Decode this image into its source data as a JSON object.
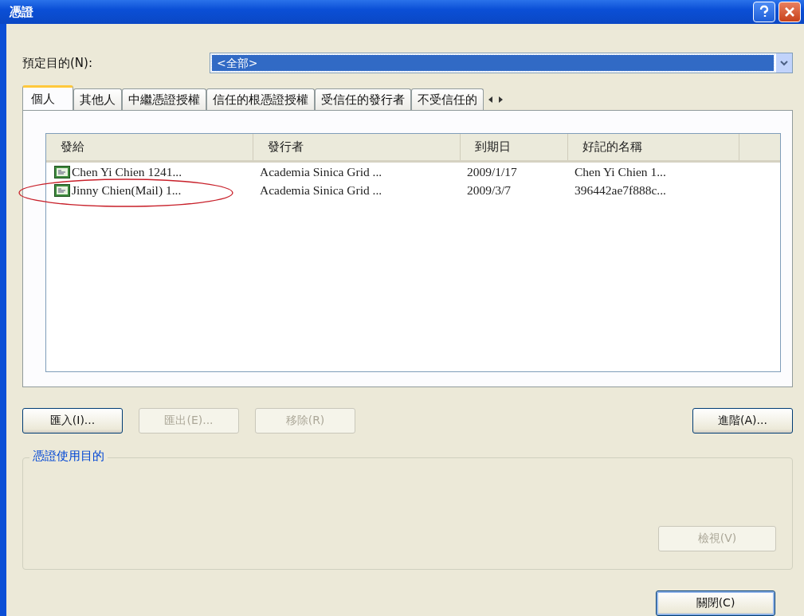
{
  "window": {
    "title": "憑證"
  },
  "purpose": {
    "label": "預定目的(N):",
    "value": "<全部>"
  },
  "tabs": [
    {
      "label": "個人",
      "selected": true
    },
    {
      "label": "其他人",
      "selected": false
    },
    {
      "label": "中繼憑證授權",
      "selected": false
    },
    {
      "label": "信任的根憑證授權",
      "selected": false
    },
    {
      "label": "受信任的發行者",
      "selected": false
    },
    {
      "label": "不受信任的",
      "selected": false
    }
  ],
  "table": {
    "columns": [
      "發給",
      "發行者",
      "到期日",
      "好記的名稱"
    ],
    "rows": [
      {
        "cells": [
          "Chen Yi Chien 1241...",
          "Academia Sinica Grid ...",
          "2009/1/17",
          "Chen Yi Chien 1..."
        ]
      },
      {
        "cells": [
          "Jinny Chien(Mail) 1...",
          "Academia Sinica Grid ...",
          "2009/3/7",
          "396442ae7f888c..."
        ]
      }
    ]
  },
  "buttons": [
    {
      "label": "匯入(I)...",
      "disabled": false
    },
    {
      "label": "匯出(E)...",
      "disabled": true
    },
    {
      "label": "移除(R)",
      "disabled": true
    }
  ],
  "advanced_button": {
    "label": "進階(A)...",
    "disabled": false
  },
  "purposes_group": {
    "title": "憑證使用目的",
    "view_button": {
      "label": "檢視(V)",
      "disabled": true
    }
  },
  "close_button": {
    "label": "關閉(C)",
    "disabled": false
  }
}
